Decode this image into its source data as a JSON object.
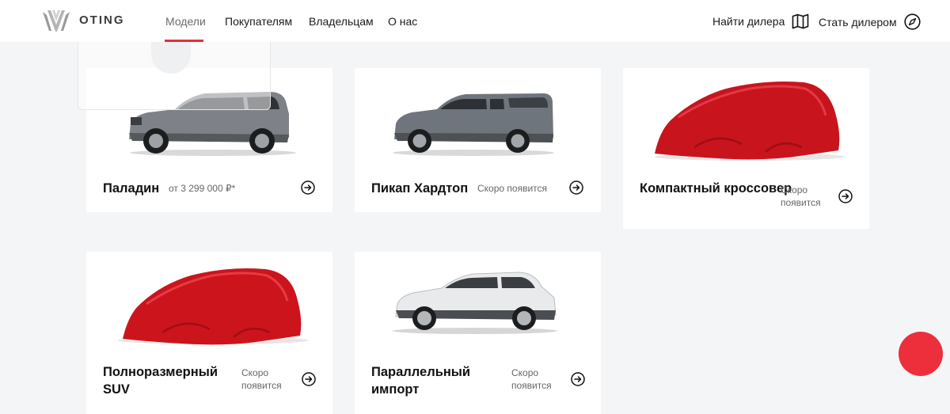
{
  "brand": {
    "name": "OTING",
    "logo_icon": "chevron-crest-logo"
  },
  "nav": {
    "items": [
      {
        "label": "Модели",
        "active": true
      },
      {
        "label": "Покупателям",
        "active": false
      },
      {
        "label": "Владельцам",
        "active": false
      },
      {
        "label": "О нас",
        "active": false
      }
    ]
  },
  "utility": {
    "find_dealer": {
      "label": "Найти дилера",
      "icon": "map-icon"
    },
    "become_dealer": {
      "label": "Стать дилером",
      "icon": "compass-icon"
    }
  },
  "models": [
    {
      "name": "Паладин",
      "meta": "от 3 299 000 ₽*",
      "image": "grey-suv-photo"
    },
    {
      "name": "Пикап Хардтоп",
      "meta": "Скоро появится",
      "image": "grey-pickup-hardtop-photo"
    },
    {
      "name": "Компактный кроссовер",
      "meta": "Скоро появится",
      "image": "red-cover-car-silhouette"
    },
    {
      "name": "Полноразмерный SUV",
      "meta": "Скоро появится",
      "image": "red-cover-car-silhouette"
    },
    {
      "name": "Параллельный импорт",
      "meta": "Скоро появится",
      "image": "white-crossover-photo"
    }
  ],
  "colors": {
    "accent": "#e0323c",
    "fab": "#ec2f3b",
    "background": "#f4f5f7",
    "card": "#ffffff"
  }
}
